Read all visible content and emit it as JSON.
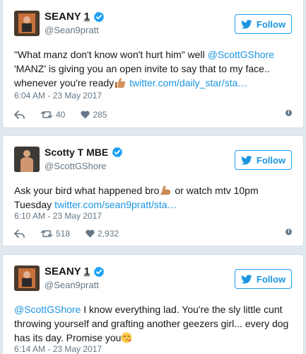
{
  "colors": {
    "accent": "#1da1f2",
    "link": "#1b95e0",
    "muted": "#657786",
    "background": "#e1e8ed"
  },
  "follow_label": "Follow",
  "tweets": [
    {
      "name": "SEANY",
      "name_symbol": "1",
      "handle": "@Sean9pratt",
      "text_a": "\"What manz don't know won't hurt him\" well ",
      "mention": "@ScottGShore",
      "text_b": " 'MANZ' is giving you an open invite to say that to my face.. whenever you're ready",
      "emoji": "thumbs-up",
      "link": "twitter.com/daily_star/sta…",
      "time": "6:04 AM - 23 May 2017",
      "retweets": "40",
      "likes": "285"
    },
    {
      "name": "Scotty T MBE",
      "handle": "@ScottGShore",
      "text_a": "Ask your bird what happened bro",
      "emoji": "flexed-biceps",
      "text_b": " or watch mtv 10pm Tuesday ",
      "link": "twitter.com/sean9pratt/sta…",
      "time": "6:10 AM - 23 May 2017",
      "retweets": "518",
      "likes": "2,932"
    },
    {
      "name": "SEANY",
      "name_symbol": "1",
      "handle": "@Sean9pratt",
      "mention": "@ScottGShore",
      "text_a": " I know everything lad. You're the sly little cunt throwing yourself and grafting another geezers girl... every dog has its day. Promise you",
      "emoji": "face-blowing-kiss",
      "time": "6:14 AM - 23 May 2017"
    }
  ]
}
